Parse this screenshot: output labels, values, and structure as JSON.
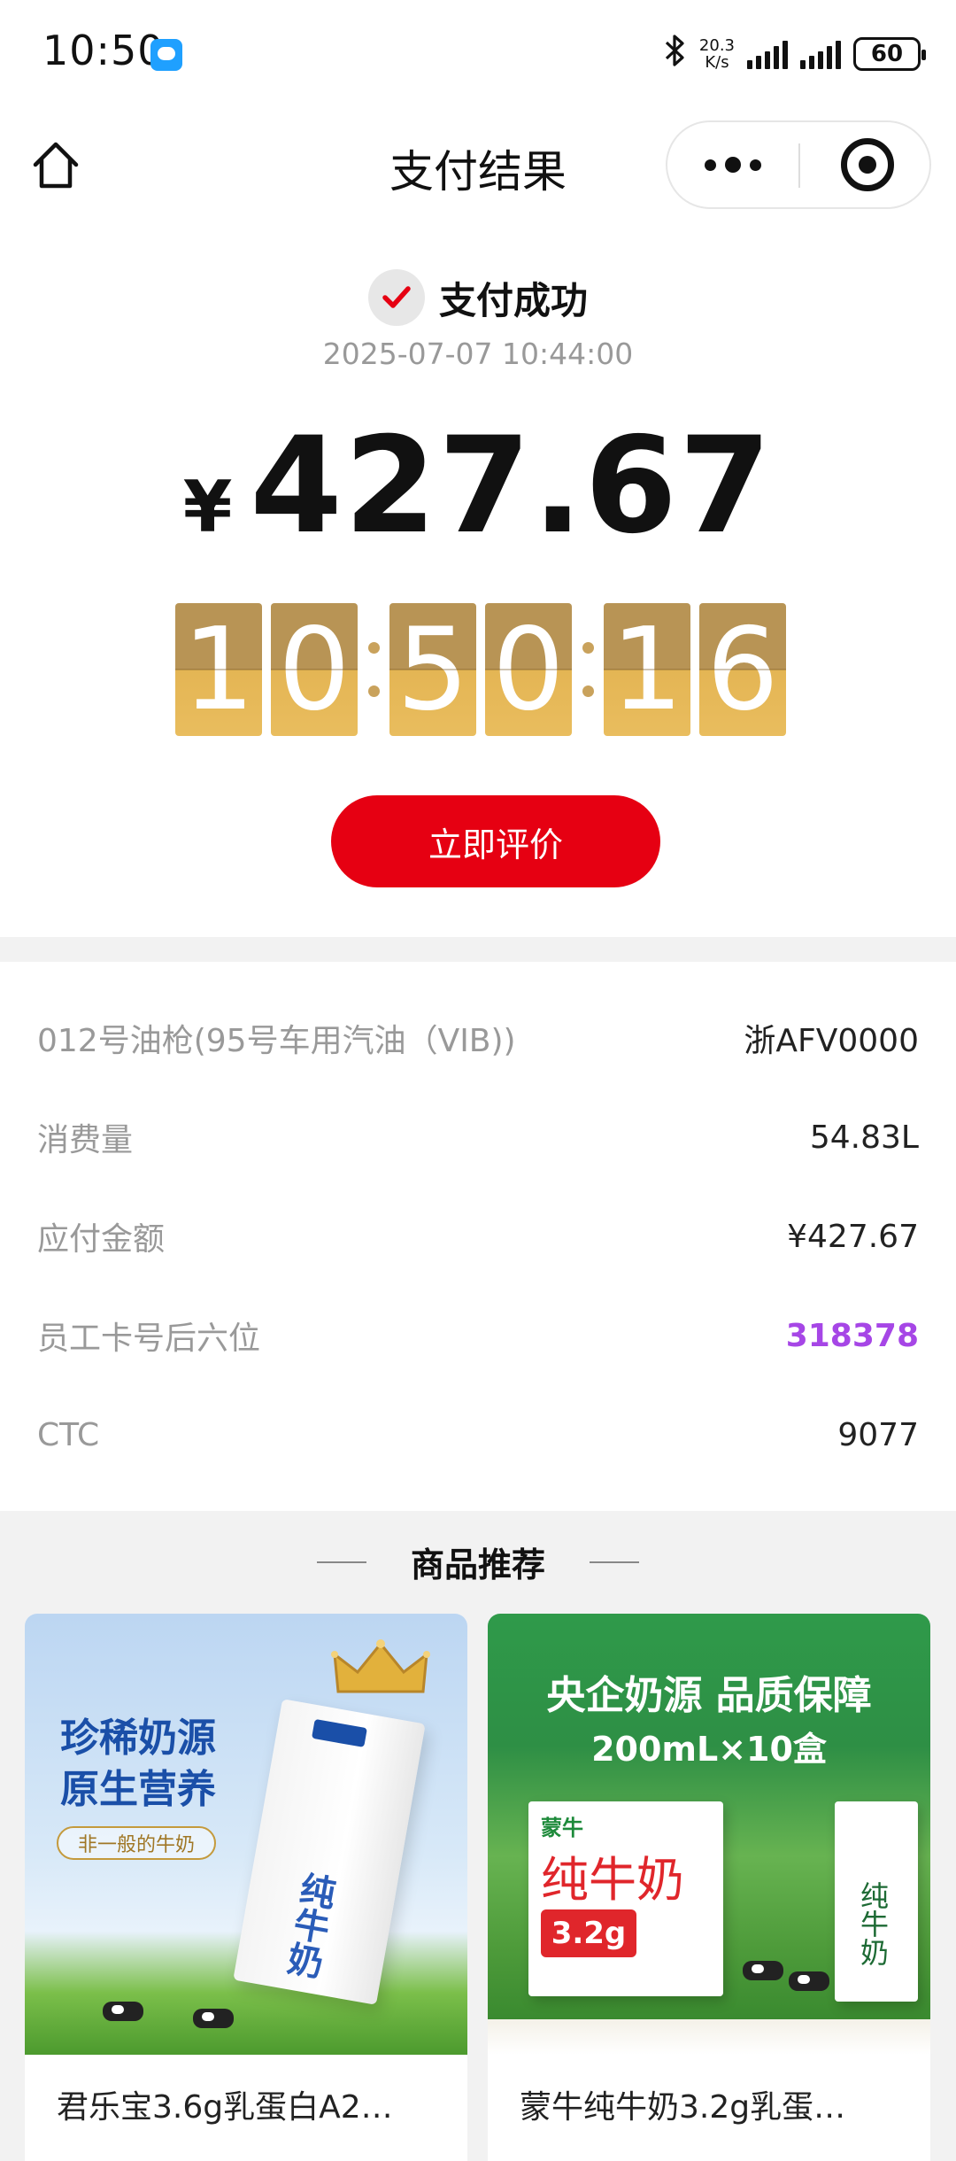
{
  "status_bar": {
    "time": "10:50",
    "net_speed_value": "20.3",
    "net_speed_unit": "K/s",
    "battery": "60"
  },
  "nav": {
    "title": "支付结果"
  },
  "result": {
    "status": "支付成功",
    "datetime": "2025-07-07 10:44:00",
    "currency": "¥",
    "amount": "427.67",
    "clock_digits": [
      "1",
      "0",
      "5",
      "0",
      "1",
      "6"
    ],
    "review_button": "立即评价"
  },
  "details": {
    "rows": [
      {
        "label": "012号油枪(95号车用汽油（VIB))",
        "value": "浙AFV0000"
      },
      {
        "label": "消费量",
        "value": "54.83L"
      },
      {
        "label": "应付金额",
        "value": "¥427.67"
      },
      {
        "label": "员工卡号后六位",
        "value": "318378"
      },
      {
        "label": "CTC",
        "value": "9077"
      }
    ],
    "accent_color": "#a646e6"
  },
  "recommend": {
    "title": "商品推荐",
    "products": [
      {
        "name": "君乐宝3.6g乳蛋白A2…",
        "image_headline": "珍稀奶源\n原生营养",
        "image_tag": "非一般的牛奶",
        "box_text": "纯牛奶"
      },
      {
        "name": "蒙牛纯牛奶3.2g乳蛋…",
        "image_headline": "央企奶源 品质保障",
        "image_subline": "200mL×10盒",
        "box_brand": "蒙牛",
        "box_text": "纯牛奶",
        "box_badge": "3.2g"
      }
    ]
  },
  "colors": {
    "primary_red": "#e60012",
    "clock_gold": "#e4b554"
  }
}
